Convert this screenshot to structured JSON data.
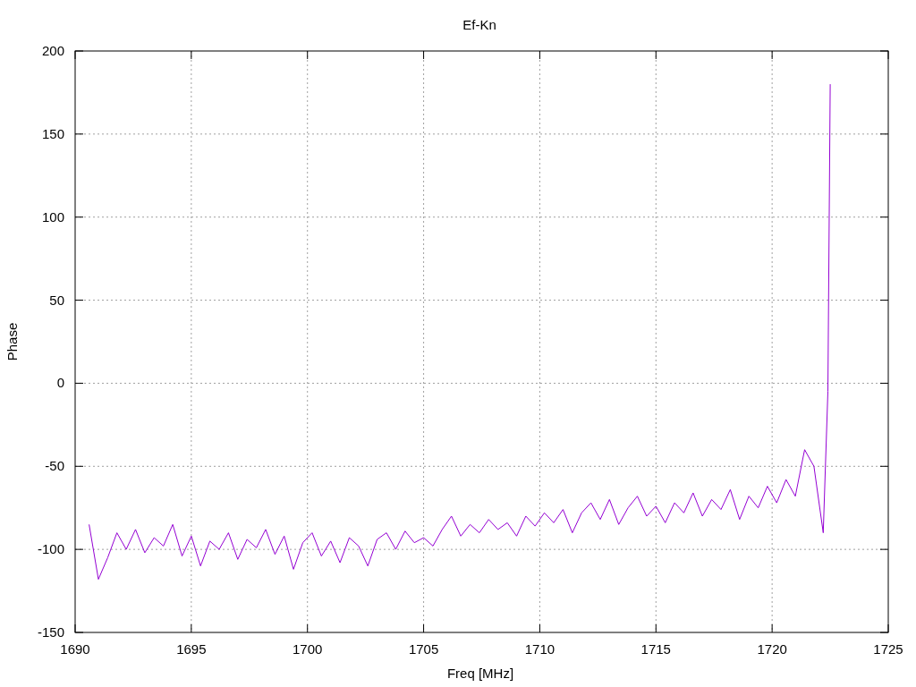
{
  "chart_data": {
    "type": "line",
    "grid": true,
    "title": "Ef-Kn",
    "xlabel": "Freq [MHz]",
    "ylabel": "Phase",
    "xlim": [
      1690,
      1725
    ],
    "ylim": [
      -150,
      200
    ],
    "xticks": [
      1690,
      1695,
      1700,
      1705,
      1710,
      1715,
      1720,
      1725
    ],
    "yticks": [
      -150,
      -100,
      -50,
      0,
      50,
      100,
      150,
      200
    ],
    "x": [
      1690.6,
      1691.0,
      1691.4,
      1691.8,
      1692.2,
      1692.6,
      1693.0,
      1693.4,
      1693.8,
      1694.2,
      1694.6,
      1695.0,
      1695.4,
      1695.8,
      1696.2,
      1696.6,
      1697.0,
      1697.4,
      1697.8,
      1698.2,
      1698.6,
      1699.0,
      1699.4,
      1699.8,
      1700.2,
      1700.6,
      1701.0,
      1701.4,
      1701.8,
      1702.2,
      1702.6,
      1703.0,
      1703.4,
      1703.8,
      1704.2,
      1704.6,
      1705.0,
      1705.4,
      1705.8,
      1706.2,
      1706.6,
      1707.0,
      1707.4,
      1707.8,
      1708.2,
      1708.6,
      1709.0,
      1709.4,
      1709.8,
      1710.2,
      1710.6,
      1711.0,
      1711.4,
      1711.8,
      1712.2,
      1712.6,
      1713.0,
      1713.4,
      1713.8,
      1714.2,
      1714.6,
      1715.0,
      1715.4,
      1715.8,
      1716.2,
      1716.6,
      1717.0,
      1717.4,
      1717.8,
      1718.2,
      1718.6,
      1719.0,
      1719.4,
      1719.8,
      1720.2,
      1720.6,
      1721.0,
      1721.4,
      1721.8,
      1722.2,
      1722.4,
      1722.5
    ],
    "series": [
      {
        "color": "#9400d3",
        "values": [
          -85,
          -118,
          -105,
          -90,
          -100,
          -88,
          -102,
          -93,
          -98,
          -85,
          -104,
          -92,
          -110,
          -95,
          -100,
          -90,
          -106,
          -94,
          -99,
          -88,
          -103,
          -92,
          -112,
          -96,
          -90,
          -104,
          -95,
          -108,
          -93,
          -98,
          -110,
          -94,
          -90,
          -100,
          -89,
          -96,
          -93,
          -98,
          -88,
          -80,
          -92,
          -85,
          -90,
          -82,
          -88,
          -84,
          -92,
          -80,
          -86,
          -78,
          -84,
          -76,
          -90,
          -78,
          -72,
          -82,
          -70,
          -85,
          -75,
          -68,
          -80,
          -74,
          -84,
          -72,
          -78,
          -66,
          -80,
          -70,
          -76,
          -64,
          -82,
          -68,
          -75,
          -62,
          -72,
          -58,
          -68,
          -40,
          -50,
          -90,
          -5,
          180
        ]
      }
    ]
  }
}
